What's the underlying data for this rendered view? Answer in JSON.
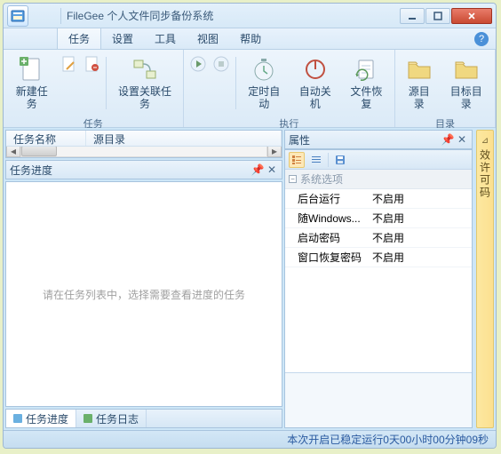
{
  "title": "FileGee 个人文件同步备份系统",
  "menu": {
    "items": [
      "任务",
      "设置",
      "工具",
      "视图",
      "帮助"
    ],
    "active": 0
  },
  "ribbon": {
    "groups": [
      {
        "label": "任务",
        "buttons": {
          "new": "新建任务",
          "assoc": "设置关联任务"
        }
      },
      {
        "label": "执行",
        "buttons": {
          "timer": "定时自动",
          "shutdown": "自动关机",
          "restore": "文件恢复"
        }
      },
      {
        "label": "目录",
        "buttons": {
          "src": "源目录",
          "dst": "目标目录"
        }
      }
    ]
  },
  "taskList": {
    "cols": [
      "任务名称",
      "源目录"
    ]
  },
  "progress": {
    "title": "任务进度",
    "placeholder": "请在任务列表中，选择需要查看进度的任务"
  },
  "footerTabs": {
    "progress": "任务进度",
    "log": "任务日志"
  },
  "props": {
    "title": "属性",
    "group": "系统选项",
    "rows": [
      {
        "k": "后台运行",
        "v": "不启用"
      },
      {
        "k": "随Windows...",
        "v": "不启用"
      },
      {
        "k": "启动密码",
        "v": "不启用"
      },
      {
        "k": "窗口恢复密码",
        "v": "不启用"
      }
    ]
  },
  "sideTab": "效许可码",
  "status": {
    "prefix": "本次开启已稳定运行 ",
    "value": "0天00小时00分钟09秒"
  }
}
